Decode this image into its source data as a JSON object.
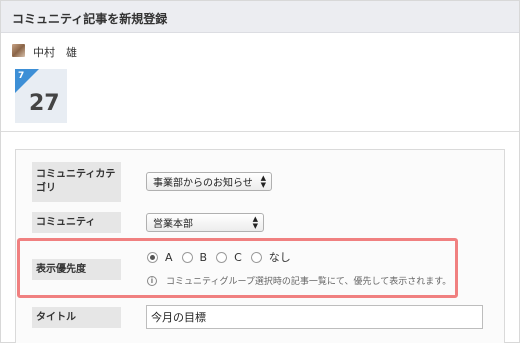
{
  "header": {
    "title": "コミュニティ記事を新規登録"
  },
  "author": {
    "name": "中村　雄"
  },
  "date": {
    "month": "7",
    "day": "27"
  },
  "form": {
    "category": {
      "label": "コミュニティカテゴリ",
      "value": "事業部からのお知らせ"
    },
    "community": {
      "label": "コミュニティ",
      "value": "営業本部"
    },
    "priority": {
      "label": "表示優先度",
      "options": [
        "A",
        "B",
        "C",
        "なし"
      ],
      "selected": "A",
      "note": "コミュニティグループ選択時の記事一覧にて、優先して表示されます。"
    },
    "title": {
      "label": "タイトル",
      "value": "今月の目標"
    }
  },
  "colors": {
    "highlight": "#f08080",
    "date_accent": "#3d8fd6",
    "header_bg": "#ecedf1"
  },
  "icons": {
    "select_arrow": "updown-arrow-icon",
    "info": "info-icon"
  }
}
